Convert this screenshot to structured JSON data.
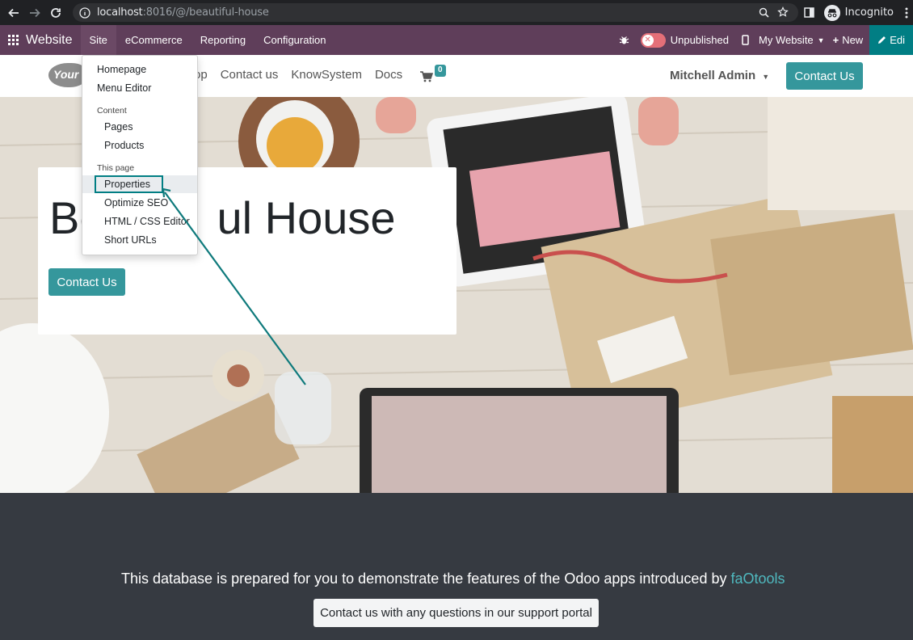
{
  "browser": {
    "url_host": "localhost",
    "url_rest": ":8016/@/beautiful-house",
    "profile_label": "Incognito"
  },
  "odoo_bar": {
    "brand": "Website",
    "menus": [
      "Site",
      "eCommerce",
      "Reporting",
      "Configuration"
    ],
    "publish_status": "Unpublished",
    "website_selector": "My Website",
    "new_label": "New",
    "edit_label": "Edi",
    "bg_color": "#5f3e5a",
    "edit_color": "#017e84"
  },
  "site_header": {
    "logo_text": "Your",
    "nav": [
      "op",
      "Contact us",
      "KnowSystem",
      "Docs"
    ],
    "cart_count": "0",
    "user_name": "Mitchell Admin",
    "cta_label": "Contact Us",
    "accent_color": "#35979c"
  },
  "dropdown": {
    "items_top": [
      "Homepage",
      "Menu Editor"
    ],
    "content_header": "Content",
    "content_items": [
      "Pages",
      "Products"
    ],
    "page_header": "This page",
    "page_items": [
      "Properties",
      "Optimize SEO",
      "HTML / CSS Editor",
      "Short URLs"
    ],
    "highlighted": "Properties"
  },
  "hero": {
    "title_visible_left": "Be",
    "title_visible_right": "ul House",
    "cta_label": "Contact Us"
  },
  "footer": {
    "text": "This database is prepared for you to demonstrate the features of the Odoo apps introduced by ",
    "link_text": "faOtools",
    "button_label": "Contact us with any questions in our support portal"
  }
}
